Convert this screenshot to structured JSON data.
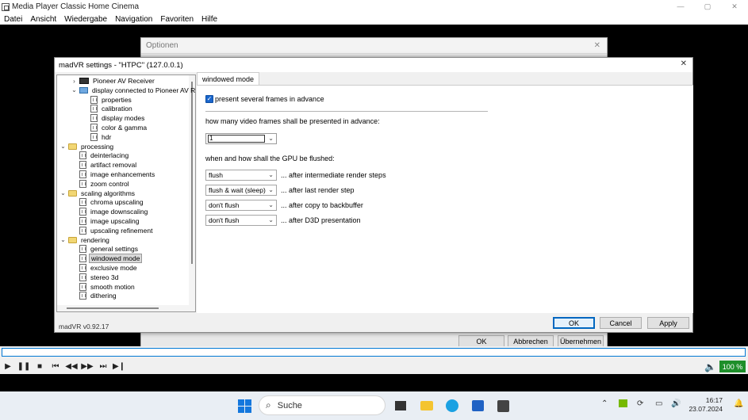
{
  "player": {
    "title": "Media Player Classic Home Cinema",
    "window_controls": [
      "—",
      "▢",
      "✕"
    ],
    "menu": [
      "Datei",
      "Ansicht",
      "Wiedergabe",
      "Navigation",
      "Favoriten",
      "Hilfe"
    ],
    "zoom": "100 %"
  },
  "options_dialog": {
    "title": "Optionen",
    "close": "✕",
    "ok": "OK",
    "cancel": "Abbrechen",
    "apply": "Übernehmen"
  },
  "madvr": {
    "title": "madVR settings - \"HTPC\" (127.0.0.1)",
    "close": "✕",
    "version": "madVR v0.92.17",
    "ok": "OK",
    "cancel": "Cancel",
    "apply": "Apply",
    "tree": [
      {
        "label": "Pioneer AV Receiver",
        "icon": "device",
        "level": 1,
        "twisty": "›"
      },
      {
        "label": "display connected to Pioneer AV R",
        "icon": "monitor",
        "level": 1,
        "twisty": "⌄"
      },
      {
        "label": "properties",
        "icon": "page",
        "level": 2,
        "twisty": ""
      },
      {
        "label": "calibration",
        "icon": "page",
        "level": 2,
        "twisty": ""
      },
      {
        "label": "display modes",
        "icon": "page",
        "level": 2,
        "twisty": ""
      },
      {
        "label": "color & gamma",
        "icon": "page",
        "level": 2,
        "twisty": ""
      },
      {
        "label": "hdr",
        "icon": "page",
        "level": 2,
        "twisty": ""
      },
      {
        "label": "processing",
        "icon": "folder",
        "level": 0,
        "twisty": "⌄"
      },
      {
        "label": "deinterlacing",
        "icon": "page",
        "level": 1,
        "twisty": ""
      },
      {
        "label": "artifact removal",
        "icon": "page",
        "level": 1,
        "twisty": ""
      },
      {
        "label": "image enhancements",
        "icon": "page",
        "level": 1,
        "twisty": ""
      },
      {
        "label": "zoom control",
        "icon": "page",
        "level": 1,
        "twisty": ""
      },
      {
        "label": "scaling algorithms",
        "icon": "folder",
        "level": 0,
        "twisty": "⌄"
      },
      {
        "label": "chroma upscaling",
        "icon": "page",
        "level": 1,
        "twisty": ""
      },
      {
        "label": "image downscaling",
        "icon": "page",
        "level": 1,
        "twisty": ""
      },
      {
        "label": "image upscaling",
        "icon": "page",
        "level": 1,
        "twisty": ""
      },
      {
        "label": "upscaling refinement",
        "icon": "page",
        "level": 1,
        "twisty": ""
      },
      {
        "label": "rendering",
        "icon": "folder",
        "level": 0,
        "twisty": "⌄"
      },
      {
        "label": "general settings",
        "icon": "page",
        "level": 1,
        "twisty": ""
      },
      {
        "label": "windowed mode",
        "icon": "page",
        "level": 1,
        "twisty": "",
        "selected": true
      },
      {
        "label": "exclusive mode",
        "icon": "page",
        "level": 1,
        "twisty": ""
      },
      {
        "label": "stereo 3d",
        "icon": "page",
        "level": 1,
        "twisty": ""
      },
      {
        "label": "smooth motion",
        "icon": "page",
        "level": 1,
        "twisty": ""
      },
      {
        "label": "dithering",
        "icon": "page",
        "level": 1,
        "twisty": ""
      }
    ],
    "page": {
      "tab": "windowed mode",
      "checkbox_label": "present several frames in advance",
      "checkbox_checked": true,
      "frames_label": "how many video frames shall be presented in advance:",
      "frames_value": "1",
      "flush_label": "when and how shall the GPU be flushed:",
      "flush_rows": [
        {
          "value": "flush",
          "after": "... after intermediate render steps"
        },
        {
          "value": "flush & wait (sleep)",
          "after": "... after last render step"
        },
        {
          "value": "don't flush",
          "after": "... after copy to backbuffer"
        },
        {
          "value": "don't flush",
          "after": "... after D3D presentation"
        }
      ]
    }
  },
  "taskbar": {
    "search_placeholder": "Suche",
    "time": "16:17",
    "date": "23.07.2024"
  }
}
